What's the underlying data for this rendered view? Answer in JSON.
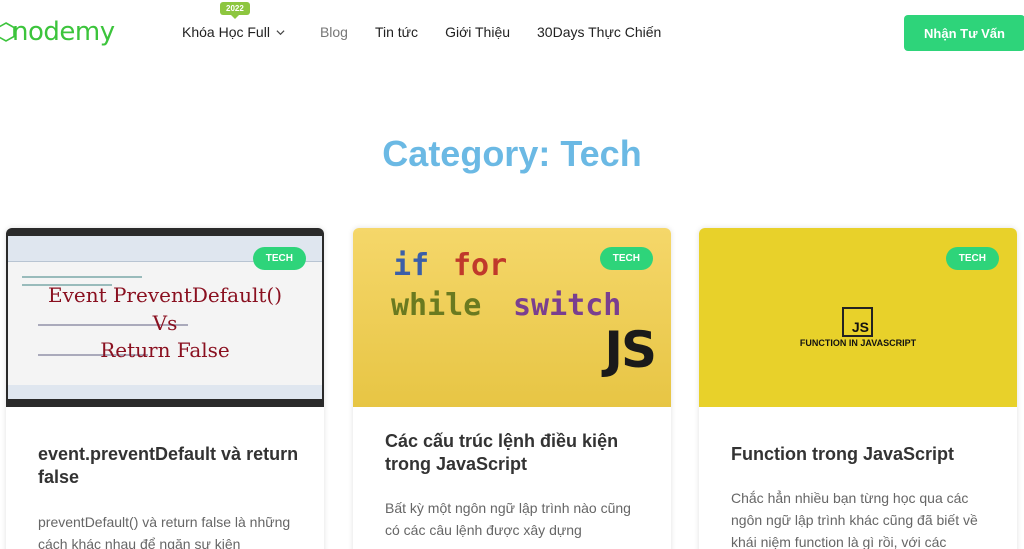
{
  "header": {
    "logo_text": "nodemy",
    "nav": [
      {
        "label": "Khóa Học Full",
        "badge": "2022"
      },
      {
        "label": "Blog"
      },
      {
        "label": "Tin tức"
      },
      {
        "label": "Giới Thiệu"
      },
      {
        "label": "30Days Thực Chiến"
      }
    ],
    "cta_label": "Nhận Tư Vấn"
  },
  "page_title": "Category: Tech",
  "colors": {
    "accent_green": "#2ed47a",
    "title_blue": "#6bb9e4",
    "logo_green": "#3cc43c"
  },
  "cards": [
    {
      "tag": "TECH",
      "title": "event.preventDefault và return false",
      "excerpt": "preventDefault() và return false là những cách khác nhau để ngăn sự kiện",
      "thumb": {
        "lines": [
          "Event PreventDefault()",
          "Vs",
          "Return False"
        ]
      }
    },
    {
      "tag": "TECH",
      "title": "Các cấu trúc lệnh điều kiện trong JavaScript",
      "excerpt": "Bất  kỳ một ngôn ngữ lập trình nào cũng có các câu lệnh được xây dựng",
      "thumb": {
        "kw_if": "if",
        "kw_for": "for",
        "kw_while": "while",
        "kw_switch": "switch",
        "logo": "JS"
      }
    },
    {
      "tag": "TECH",
      "title": "Function trong JavaScript",
      "excerpt": "Chắc hẳn nhiều bạn từng học qua các ngôn ngữ lập trình khác cũng đã biết về khái niệm function là gì rồi, với các",
      "thumb": {
        "logo": "JS",
        "caption": "FUNCTION IN JAVASCRIPT"
      }
    }
  ]
}
